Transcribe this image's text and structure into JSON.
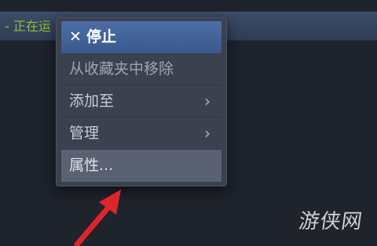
{
  "topbar": {
    "status_text": "- 正在运"
  },
  "context_menu": {
    "items": [
      {
        "icon": "close-icon",
        "icon_glyph": "✕",
        "label": "停止",
        "style": "primary"
      },
      {
        "label": "从收藏夹中移除",
        "style": "dim"
      },
      {
        "label": "添加至",
        "submenu_glyph": "›"
      },
      {
        "label": "管理",
        "submenu_glyph": "›"
      },
      {
        "label": "属性...",
        "style": "hover"
      }
    ]
  },
  "colors": {
    "background": "#1e232c",
    "menu_background": "#3c4150",
    "primary_item": "#4d6da7",
    "status_green": "#8fbf3a",
    "annotation_arrow": "#e0242b"
  },
  "watermark": {
    "text": "游侠网"
  }
}
